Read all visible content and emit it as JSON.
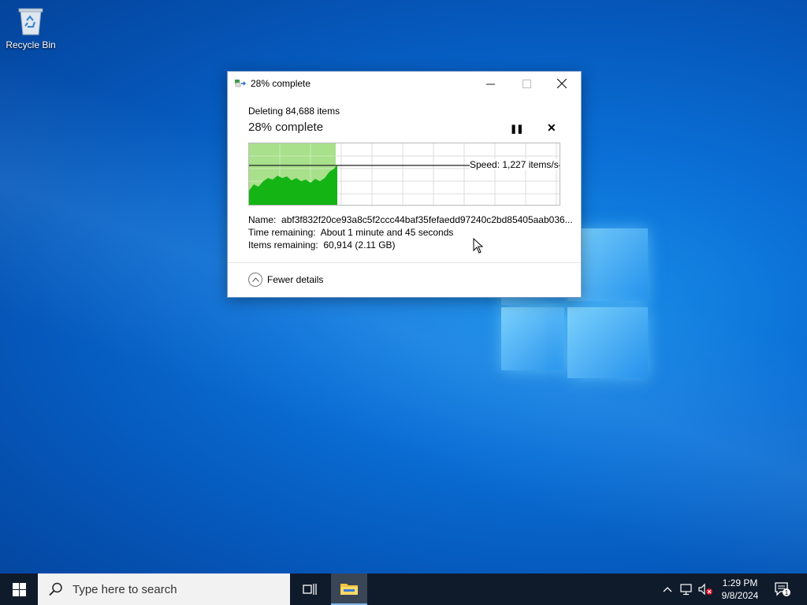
{
  "desktop": {
    "recycle_bin_label": "Recycle Bin"
  },
  "dialog": {
    "window_title": "28% complete",
    "operation": "Deleting 84,688 items",
    "percent_text": "28% complete",
    "progress": 0.28,
    "speed": "Speed: 1,227 items/s",
    "name_label": "Name:",
    "name_value": "abf3f832f20ce93a8c5f2ccc44baf35fefaedd97240c2bd85405aab036...",
    "time_label": "Time remaining:",
    "time_value": "About 1 minute and 45 seconds",
    "items_label": "Items remaining:",
    "items_value": "60,914 (2.11 GB)",
    "fewer_details": "Fewer details"
  },
  "taskbar": {
    "search_placeholder": "Type here to search",
    "time": "1:29 PM",
    "date": "9/8/2024",
    "notification_count": "1"
  },
  "colors": {
    "progress_fill_light": "#a8e08c",
    "progress_fill_dark": "#14b414",
    "taskbar_bg": "#0f1a2b"
  }
}
